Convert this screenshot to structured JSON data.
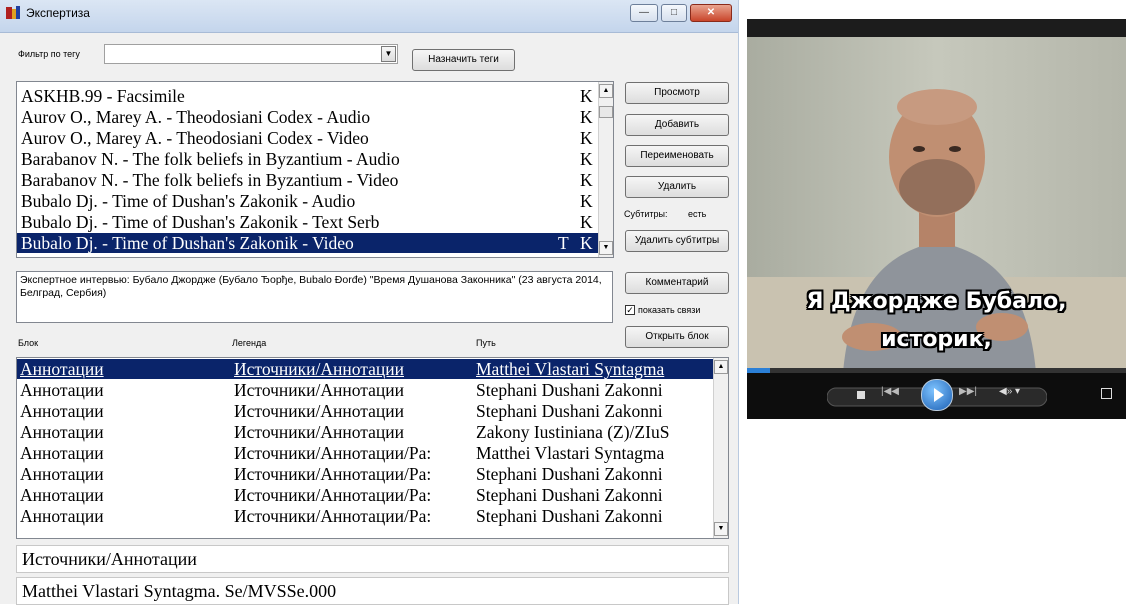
{
  "window": {
    "title": "Экспертиза",
    "buttons": {
      "minimize": "—",
      "maximize": "□",
      "close": "✕"
    }
  },
  "filter": {
    "label": "Фильтр по тегу",
    "value": "",
    "assign_tags_button": "Назначить теги"
  },
  "materials": [
    {
      "name": "ASKHB.99  -  Facsimile",
      "t": "",
      "k": "K",
      "selected": false
    },
    {
      "name": "Aurov O., Marey A.  -  Theodosiani  Codex  -  Audio",
      "t": "",
      "k": "K",
      "selected": false
    },
    {
      "name": "Aurov O., Marey A.  -  Theodosiani  Codex  -  Video",
      "t": "",
      "k": "K",
      "selected": false
    },
    {
      "name": "Barabanov N.  -  The  folk beliefs in Byzantium  -  Audio",
      "t": "",
      "k": "K",
      "selected": false
    },
    {
      "name": "Barabanov N.  -  The  folk beliefs in Byzantium  -  Video",
      "t": "",
      "k": "K",
      "selected": false
    },
    {
      "name": "Bubalo Dj.  -  Time  of  Dushan's Zakonik  -  Audio",
      "t": "",
      "k": "K",
      "selected": false
    },
    {
      "name": "Bubalo Dj.  -  Time  of  Dushan's Zakonik  -  Text  Serb",
      "t": "",
      "k": "K",
      "selected": false
    },
    {
      "name": "Bubalo Dj.  -  Time  of  Dushan's Zakonik  -  Video",
      "t": "T",
      "k": "K",
      "selected": true
    }
  ],
  "side_buttons": {
    "view": "Просмотр",
    "add": "Добавить",
    "rename": "Переименовать",
    "delete": "Удалить",
    "subtitles_label": "Субтитры:",
    "subtitles_value": "есть",
    "delete_subtitles": "Удалить субтитры",
    "comment": "Комментарий",
    "show_links": "показать связи",
    "show_links_checked": true,
    "open_block": "Открыть блок"
  },
  "description": "Экспертное интервью: Бубало Джордже (Бубало Ђорђе, Bubalo Đorđe) \"Время Душанова Законника\" (23 августа 2014, Белград, Сербия)",
  "grid": {
    "headers": {
      "block": "Блок",
      "legend": "Легенда",
      "path": "Путь"
    },
    "rows": [
      {
        "block": "Аннотации",
        "legend": "Источники/Аннотации",
        "path": "Matthei  Vlastari  Syntagma",
        "selected": true
      },
      {
        "block": "Аннотации",
        "legend": "Источники/Аннотации",
        "path": "Stephani  Dushani  Zakonni",
        "selected": false
      },
      {
        "block": "Аннотации",
        "legend": "Источники/Аннотации",
        "path": "Stephani  Dushani  Zakonni",
        "selected": false
      },
      {
        "block": "Аннотации",
        "legend": "Источники/Аннотации",
        "path": "Zakony  Iustiniana  (Z)/ZIuS",
        "selected": false
      },
      {
        "block": "Аннотации",
        "legend": "Источники/Аннотации/Ра:",
        "path": "Matthei  Vlastari  Syntagma",
        "selected": false
      },
      {
        "block": "Аннотации",
        "legend": "Источники/Аннотации/Ра:",
        "path": "Stephani  Dushani  Zakonni",
        "selected": false
      },
      {
        "block": "Аннотации",
        "legend": "Источники/Аннотации/Ра:",
        "path": "Stephani  Dushani  Zakonni",
        "selected": false
      },
      {
        "block": "Аннотации",
        "legend": "Источники/Аннотации/Ра:",
        "path": "Stephani  Dushani  Zakonni",
        "selected": false
      }
    ]
  },
  "legend_field": "Источники/Аннотации",
  "path_field": "Matthei  Vlastari  Syntagma. Se/MVSSe.000",
  "video": {
    "subtitle_line1": "Я Джордже Бубало,",
    "subtitle_line2": "историк,",
    "progress": 0.06,
    "colors": {
      "accent": "#2b7fd6",
      "background": "#0d0d0d"
    }
  }
}
